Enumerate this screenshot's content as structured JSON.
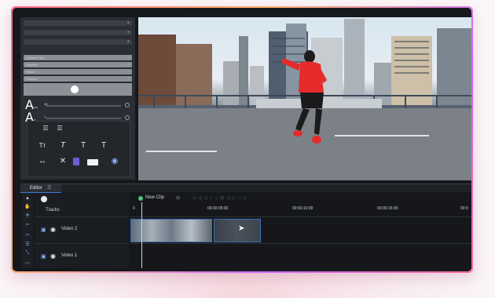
{
  "panel": {
    "rows": [
      {
        "label": "",
        "chev": "▸"
      },
      {
        "label": "",
        "chev": "▸"
      },
      {
        "label": "",
        "chev": "▸"
      },
      {
        "label": "Animate Text",
        "chev": "▸"
      },
      {
        "label": "Shadow",
        "chev": "▸"
      },
      {
        "label": "Stroke",
        "chev": "▸"
      },
      {
        "label": "Shadow",
        "chev": "▾"
      }
    ],
    "font_size_label": "A",
    "font_size_sub": "Aa",
    "font_size_value": "28",
    "opacity_label": "A",
    "opacity_value": "1"
  },
  "format_tools": {
    "align_left": "☰",
    "align_center": "☰",
    "t1": "Tт",
    "t2": "T",
    "t3": "T",
    "t4": "T",
    "resize": "↔",
    "remove": "✕",
    "eye": "◉"
  },
  "editor": {
    "tab_label": "Editor",
    "menu_glyph": "☰",
    "tracks_label": "Tracks",
    "new_clip_label": "New Clip",
    "ticks": [
      "0",
      "00:00:05:00",
      "00:00:10:00",
      "00:00:15:00",
      "00:0"
    ],
    "track_labels": [
      "Video 2",
      "Video 1"
    ]
  },
  "colors": {
    "accent": "#3f7bd8",
    "frame_gradient": [
      "#ff6b8b",
      "#ffb36b",
      "#c86bff"
    ],
    "jacket": "#e52b2b"
  }
}
